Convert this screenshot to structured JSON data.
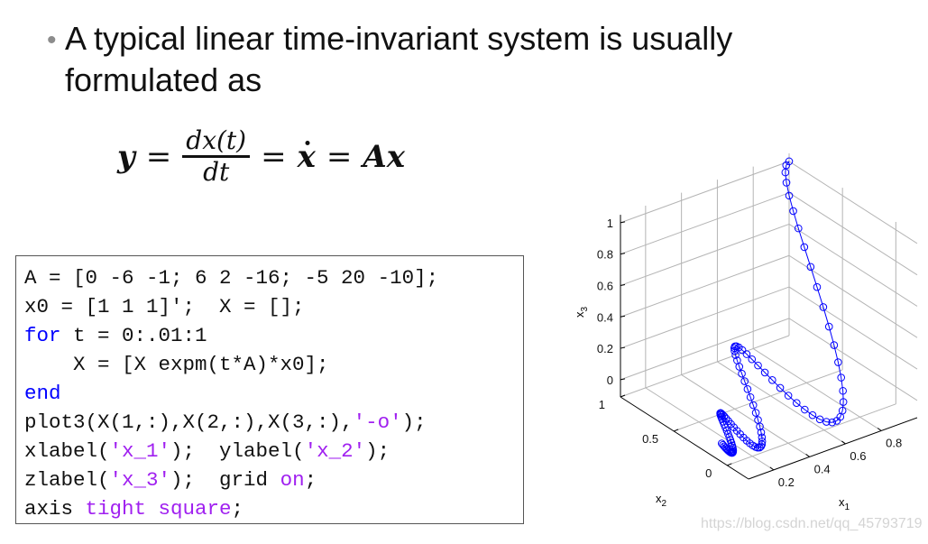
{
  "slide": {
    "bullet_glyph": "•",
    "title": "A typical linear time-invariant system is usually formulated as"
  },
  "equation": {
    "lhs": "y",
    "eq1": "=",
    "numerator": "dx(t)",
    "denominator": "dt",
    "eq2": "=",
    "xdot": "x",
    "eq3": "=",
    "rhs": "Ax"
  },
  "code": {
    "lines": [
      [
        {
          "text": "A = [0 -6 -1; 6 2 -16; -5 20 -10];",
          "kind": "plain"
        }
      ],
      [
        {
          "text": "x0 = [1 1 1]';  X = [];",
          "kind": "plain"
        }
      ],
      [
        {
          "text": "for",
          "kind": "kw"
        },
        {
          "text": " t = 0:.01:1",
          "kind": "plain"
        }
      ],
      [
        {
          "text": "    X = [X expm(t*A)*x0];",
          "kind": "plain"
        }
      ],
      [
        {
          "text": "end",
          "kind": "kw"
        }
      ],
      [
        {
          "text": "plot3(X(1,:),X(2,:),X(3,:),",
          "kind": "plain"
        },
        {
          "text": "'-o'",
          "kind": "str"
        },
        {
          "text": ");",
          "kind": "plain"
        }
      ],
      [
        {
          "text": "xlabel(",
          "kind": "plain"
        },
        {
          "text": "'x_1'",
          "kind": "str"
        },
        {
          "text": ");  ylabel(",
          "kind": "plain"
        },
        {
          "text": "'x_2'",
          "kind": "str"
        },
        {
          "text": ");",
          "kind": "plain"
        }
      ],
      [
        {
          "text": "zlabel(",
          "kind": "plain"
        },
        {
          "text": "'x_3'",
          "kind": "str"
        },
        {
          "text": ");  grid ",
          "kind": "plain"
        },
        {
          "text": "on",
          "kind": "str"
        },
        {
          "text": ";",
          "kind": "plain"
        }
      ],
      [
        {
          "text": "axis ",
          "kind": "plain"
        },
        {
          "text": "tight square",
          "kind": "str"
        },
        {
          "text": ";",
          "kind": "plain"
        }
      ]
    ],
    "colors": {
      "plain": "#111111",
      "kw": "#0000ff",
      "str": "#a020f0"
    }
  },
  "chart_data": {
    "type": "line3d",
    "system": {
      "A": [
        [
          0,
          -6,
          -1
        ],
        [
          6,
          2,
          -16
        ],
        [
          -5,
          20,
          -10
        ]
      ],
      "x0": [
        1,
        1,
        1
      ],
      "t": [
        0,
        0.01,
        1
      ]
    },
    "marker": "o",
    "line_color": "#0000ff",
    "grid": true,
    "xlabel": "x_1",
    "ylabel": "x_2",
    "zlabel": "x_3",
    "xlim": [
      0.06,
      1.0
    ],
    "ylim": [
      -0.2,
      1.0
    ],
    "zlim": [
      -0.11,
      1.05
    ],
    "xticks": [
      "0.2",
      "0.4",
      "0.6",
      "0.8"
    ],
    "yticks": [
      "0",
      "0.5",
      "1"
    ],
    "zticks": [
      "0",
      "0.2",
      "0.4",
      "0.6",
      "0.8",
      "1"
    ]
  },
  "watermark": "https://blog.csdn.net/qq_45793719"
}
